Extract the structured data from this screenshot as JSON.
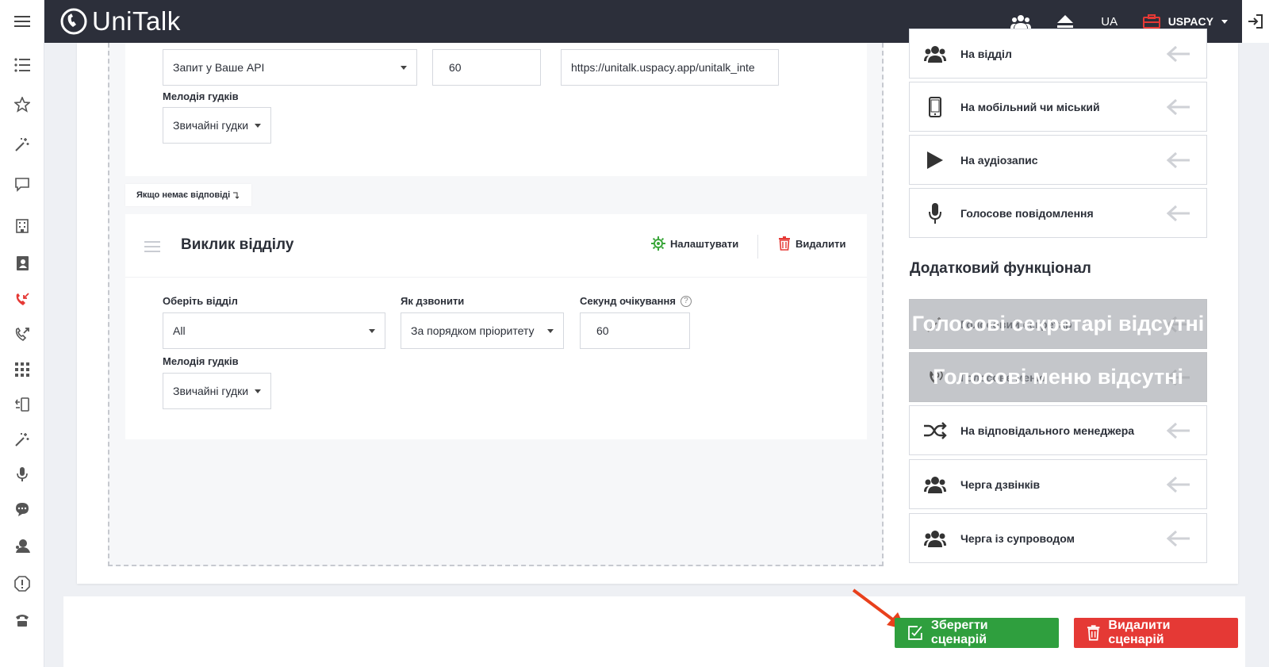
{
  "brand": {
    "name": "UniTalk"
  },
  "topbar": {
    "lang": "UA",
    "company": "USPACY"
  },
  "block1": {
    "request_select": "Запит у Ваше API",
    "timeout_value": "60",
    "url_value": "https://unitalk.uspacy.app/unitalk_inte",
    "melody_label": "Мелодія гудків",
    "melody_select": "Звичайні гудки"
  },
  "no_answer_label": "Якщо немає відповіді",
  "block2": {
    "title": "Виклик відділу",
    "settings_label": "Налаштувати",
    "delete_label": "Видалити",
    "dept_label": "Оберіть відділ",
    "dept_select": "All",
    "how_label": "Як дзвонити",
    "how_select": "За порядком пріоритету",
    "wait_label": "Секунд очікування",
    "wait_value": "60",
    "melody_label": "Мелодія гудків",
    "melody_select": "Звичайні гудки"
  },
  "actions": [
    {
      "label": "На відділ",
      "icon": "group-icon"
    },
    {
      "label": "На мобільний чи міський",
      "icon": "mobile-icon"
    },
    {
      "label": "На аудіозапис",
      "icon": "play-icon"
    },
    {
      "label": "Голосове повідомлення",
      "icon": "microphone-icon"
    }
  ],
  "extra_title": "Додатковий функціонал",
  "extra_actions": [
    {
      "label": "Голосовий секретар",
      "overlay": "Голосові секретарі відсутні",
      "icon": "magic-icon",
      "disabled": true
    },
    {
      "label": "Голосове меню",
      "overlay": "Голосові меню відсутні",
      "icon": "phone-wave-icon",
      "disabled": true
    },
    {
      "label": "На відповідального менеджера",
      "icon": "shuffle-icon",
      "disabled": false
    },
    {
      "label": "Черга дзвінків",
      "icon": "group-icon",
      "disabled": false
    },
    {
      "label": "Черга із супроводом",
      "icon": "group-icon",
      "disabled": false
    }
  ],
  "buttons": {
    "save": "Зберегти сценарій",
    "delete": "Видалити сценарій"
  },
  "colors": {
    "topbar": "#2c2f3a",
    "save": "#2f9f3e",
    "delete": "#e53935",
    "settings_icon": "#3aa63a",
    "delete_icon": "#e53935"
  }
}
